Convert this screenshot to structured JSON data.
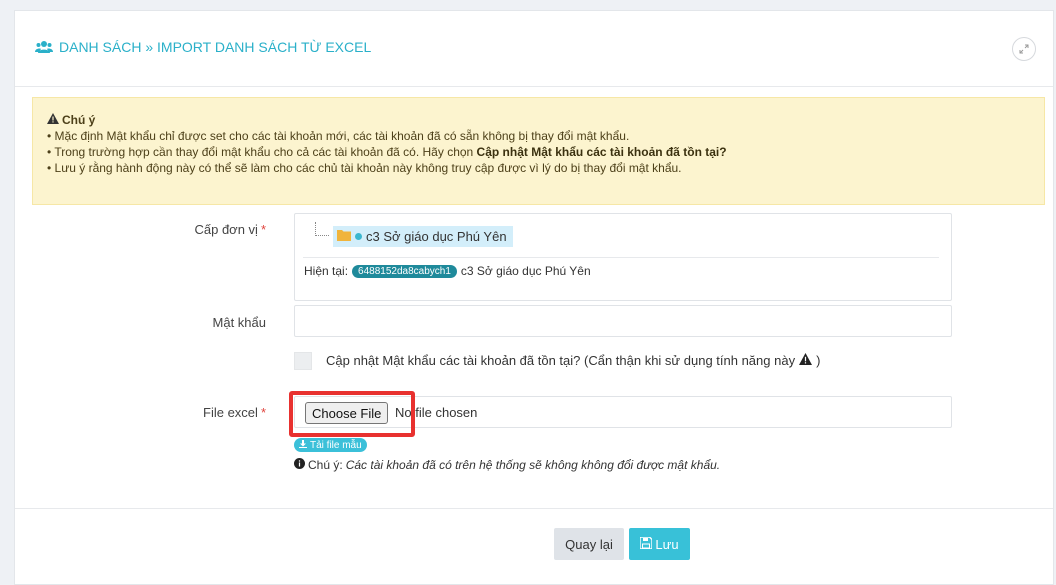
{
  "header": {
    "title": "DANH SÁCH » IMPORT DANH SÁCH TỪ EXCEL",
    "icon": "users-icon",
    "accent_color": "#2ab0c9"
  },
  "warning": {
    "title": "Chú ý",
    "line1": "• Mặc định Mật khẩu chỉ được set cho các tài khoản mới, các tài khoản đã có sẵn không bị thay đổi mật khẩu.",
    "line2_prefix": "• Trong trường hợp cần thay đổi mật khẩu cho cả các tài khoản đã có. Hãy chọn ",
    "line2_bold": "Cập nhật Mật khẩu các tài khoản đã tồn tại?",
    "line3": "• Lưu ý rằng hành động này có thể sẽ làm cho các chủ tài khoản này không truy cập được vì lý do bị thay đổi mật khẩu."
  },
  "form": {
    "unit_label": "Cấp đơn vị",
    "required_mark": "*",
    "tree_node": "c3 Sở giáo dục Phú Yên",
    "current_label": "Hiện tại:",
    "current_badge": "6488152da8cabych1",
    "current_value": "c3 Sở giáo dục Phú Yên",
    "password_label": "Mật khẩu",
    "password_value": "",
    "update_password_label": "Cập nhật Mật khẩu các tài khoản đã tồn tại? (Cẩn thận khi sử dụng tính năng này",
    "update_password_checked": false,
    "file_label": "File excel",
    "choose_file": "Choose File",
    "no_file": "No file chosen",
    "template_button": "Tải file mẫu",
    "note_prefix": "Chú ý:",
    "note_text": "Các tài khoản đã có trên hệ thống sẽ không không đổi được mật khẩu."
  },
  "footer": {
    "back": "Quay lại",
    "save": "Lưu"
  }
}
